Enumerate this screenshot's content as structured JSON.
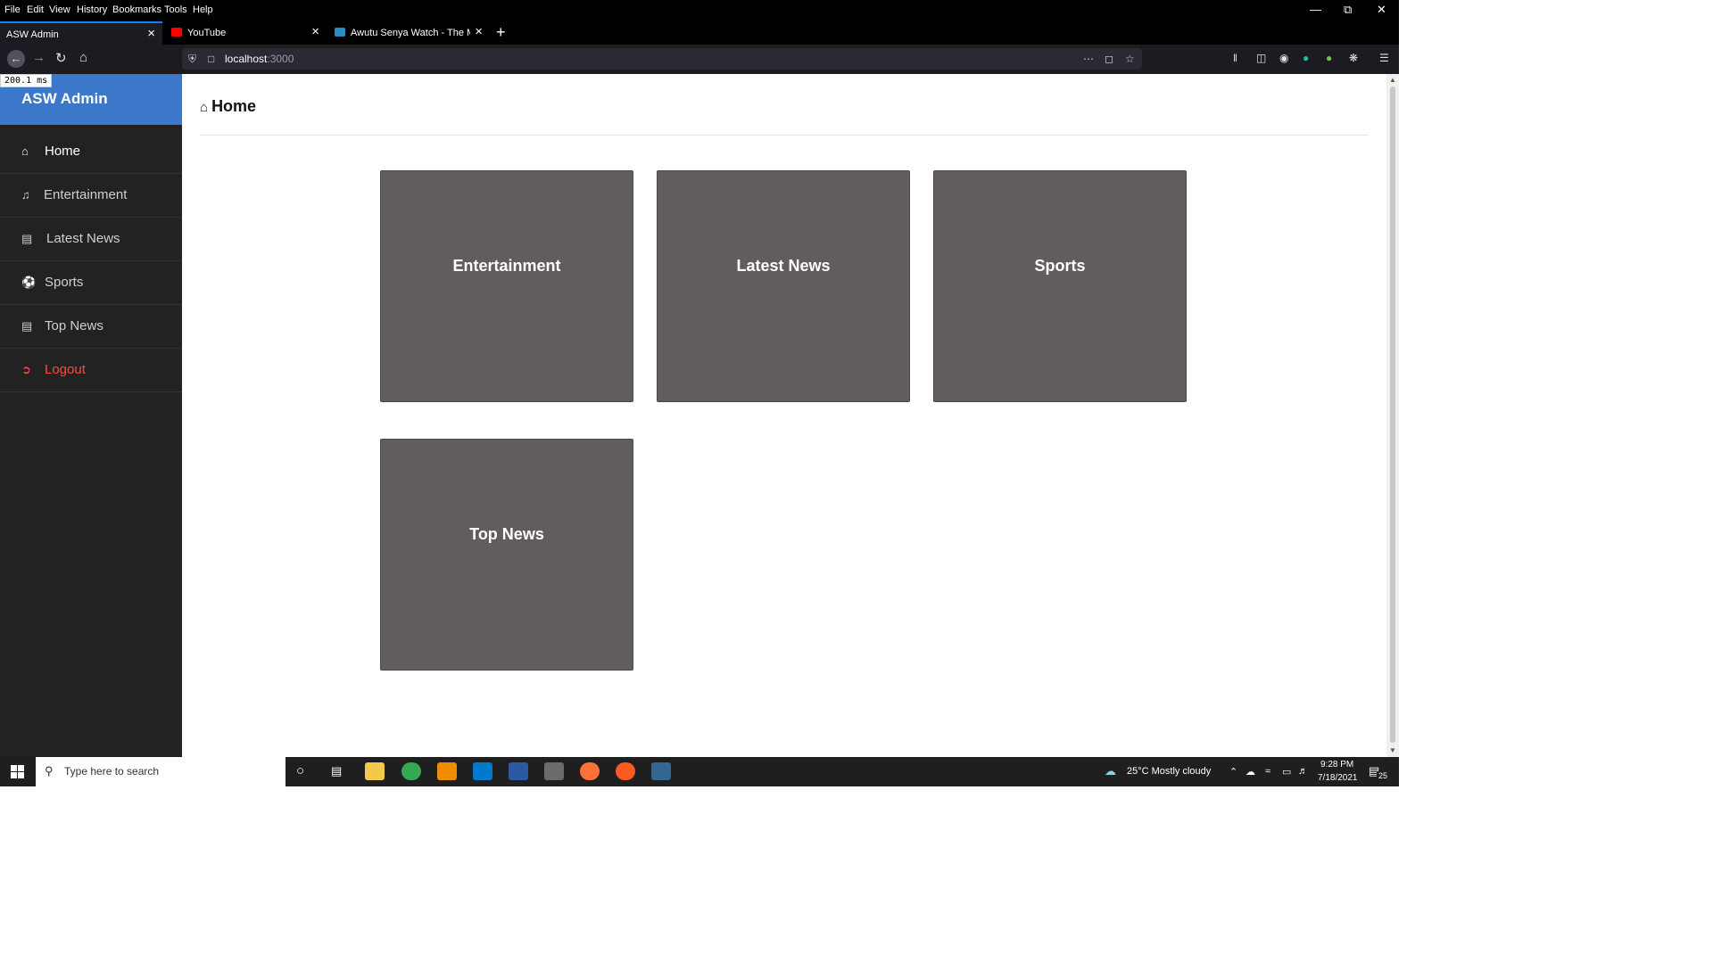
{
  "browser": {
    "menu": [
      "File",
      "Edit",
      "View",
      "History",
      "Bookmarks",
      "Tools",
      "Help"
    ],
    "tabs": [
      {
        "title": "ASW Admin",
        "active": true
      },
      {
        "title": "YouTube",
        "active": false
      },
      {
        "title": "Awutu Senya Watch - The Mou",
        "active": false
      }
    ],
    "url": "localhost:3000",
    "url_host": "localhost",
    "url_port": ":3000"
  },
  "perf_badge": "200.1 ms",
  "sidebar": {
    "brand": "ASW Admin",
    "items": [
      {
        "label": "Home",
        "icon": "home-icon"
      },
      {
        "label": "Entertainment",
        "icon": "music-icon"
      },
      {
        "label": "Latest News",
        "icon": "newspaper-icon"
      },
      {
        "label": "Sports",
        "icon": "soccer-ball-icon"
      },
      {
        "label": "Top News",
        "icon": "list-icon"
      },
      {
        "label": "Logout",
        "icon": "sign-out-icon"
      }
    ]
  },
  "main": {
    "title": "Home",
    "cards": [
      "Entertainment",
      "Latest News",
      "Sports",
      "Top News"
    ]
  },
  "taskbar": {
    "search_placeholder": "Type here to search",
    "weather": "25°C  Mostly cloudy",
    "time": "9:28 PM",
    "date": "7/18/2021",
    "notifications": "25"
  },
  "colors": {
    "sidebar_bg": "#222222",
    "brand_bg": "#3b78c9",
    "card_bg": "#605d5c",
    "logout": "#ff4a3d"
  }
}
